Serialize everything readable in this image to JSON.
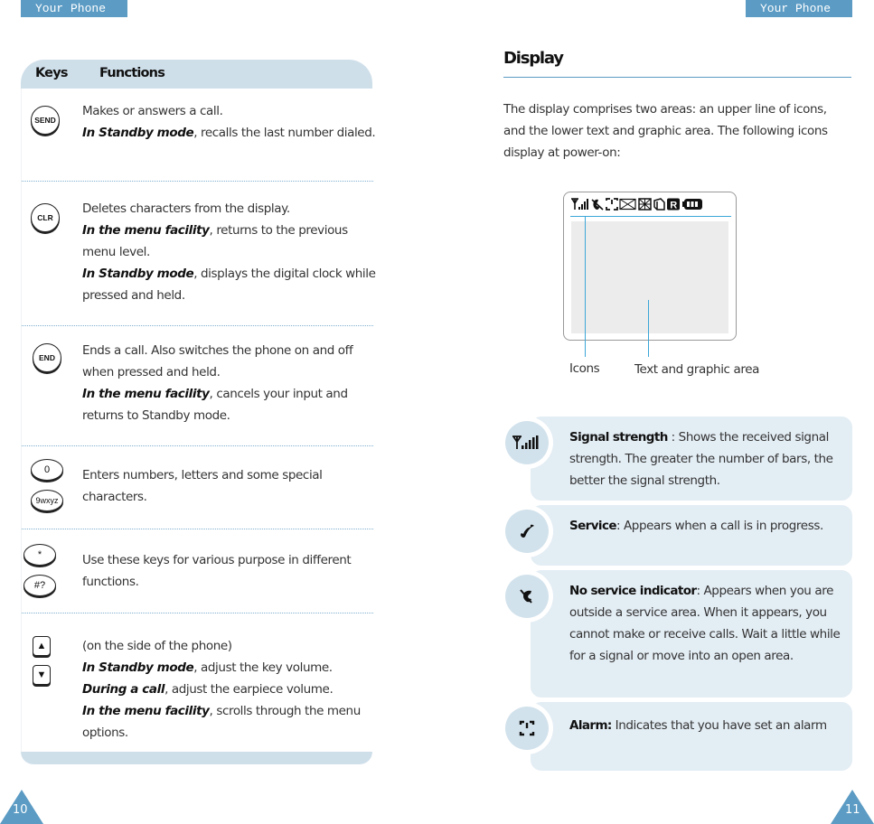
{
  "header": {
    "left_tag": "Your Phone",
    "right_tag": "Your Phone"
  },
  "keys_table": {
    "col_keys": "Keys",
    "col_functions": "Functions",
    "rows": [
      {
        "key_icon": "send-key",
        "key_label": "SEND",
        "lines": [
          {
            "plain": "Makes or answers a call."
          },
          {
            "em": "In Standby mode",
            "plain": ", recalls the last number dialed."
          }
        ]
      },
      {
        "key_icon": "clr-key",
        "key_label": "CLR",
        "lines": [
          {
            "plain": "Deletes characters from the display."
          },
          {
            "em": "In the menu facility",
            "plain": ", returns to the previous menu level."
          },
          {
            "em": "In Standby mode",
            "plain": ", displays the digital clock while pressed and held."
          }
        ]
      },
      {
        "key_icon": "end-key",
        "key_label": "END",
        "lines": [
          {
            "plain": "Ends a call. Also switches the phone on and off when pressed and held."
          },
          {
            "em": "In the menu facility",
            "plain": ", cancels your input and returns to Standby mode."
          }
        ]
      },
      {
        "key_icon": "number-keys",
        "key_label_top": "0",
        "key_label_bottom": "9wxyz",
        "lines": [
          {
            "plain": "Enters numbers, letters and some special characters."
          }
        ]
      },
      {
        "key_icon": "star-hash-keys",
        "key_label_top": "*",
        "key_label_bottom": "#?",
        "lines": [
          {
            "plain": "Use these keys for various purpose in different functions."
          }
        ]
      },
      {
        "key_icon": "volume-keys",
        "key_label_top": "▲",
        "key_label_bottom": "▼",
        "lines": [
          {
            "plain": "(on the side of the phone)"
          },
          {
            "em": "In Standby mode",
            "plain": ", adjust the key volume."
          },
          {
            "em": "During a call",
            "plain": ", adjust the earpiece volume."
          },
          {
            "em": "In the menu facility",
            "plain": ", scrolls through the menu options."
          }
        ]
      }
    ]
  },
  "display_section": {
    "title": "Display",
    "intro": "The display comprises two areas: an upper line of icons, and the lower text and graphic area. The following icons display at power-on:",
    "lcd_icons": "Y.ıllı ✆ ⏰ ✉ ▦ ⎘ R ▭",
    "label_icons": "Icons",
    "label_text_area": "Text and graphic area"
  },
  "icon_descriptions": [
    {
      "icon": "signal-strength-icon",
      "glyph": "Y.ıll",
      "title": "Signal strength",
      "text": " : Shows the received signal strength. The greater the number of bars, the better the signal strength."
    },
    {
      "icon": "service-icon",
      "glyph": "✆",
      "title": "Service",
      "text": ": Appears when a call is in progress."
    },
    {
      "icon": "no-service-icon",
      "glyph": "✗",
      "title": "No service indicator",
      "text": ": Appears when you are outside a service area. When it appears, you cannot make or receive calls. Wait a little while for a signal or move into an open area."
    },
    {
      "icon": "alarm-icon",
      "glyph": "⏻",
      "title": "Alarm:",
      "text": " Indicates that you have set an alarm"
    }
  ],
  "page_numbers": {
    "left": "10",
    "right": "11"
  },
  "colors": {
    "accent": "#5b9bc4",
    "table_header": "#cfdfea",
    "card_bg": "#e3edf4",
    "leader_line": "#3ba6d8"
  }
}
